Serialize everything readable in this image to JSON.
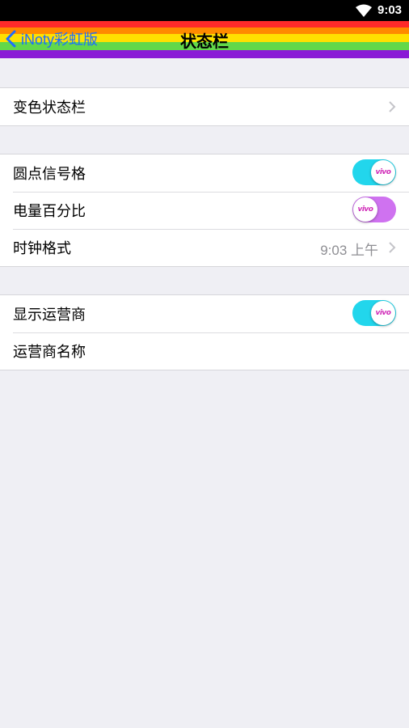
{
  "status_bar": {
    "time": "9:03",
    "icons": [
      "wifi-icon"
    ]
  },
  "navbar": {
    "back_label": "iNoty彩虹版",
    "title": "状态栏",
    "rainbow_colors": [
      "#ff2a2a",
      "#ff8a00",
      "#ffe000",
      "#62d84a",
      "#8a1ad6"
    ]
  },
  "groups": [
    {
      "rows": [
        {
          "label": "变色状态栏",
          "accessory": "chevron"
        }
      ]
    },
    {
      "rows": [
        {
          "label": "圆点信号格",
          "accessory": "toggle",
          "state": "on"
        },
        {
          "label": "电量百分比",
          "accessory": "toggle",
          "state": "off"
        },
        {
          "label": "时钟格式",
          "detail": "9:03 上午",
          "accessory": "chevron"
        }
      ]
    },
    {
      "rows": [
        {
          "label": "显示运营商",
          "accessory": "toggle",
          "state": "on"
        },
        {
          "label": "运营商名称"
        }
      ]
    }
  ],
  "toggle_knob_text": "vivo",
  "colors": {
    "toggle_on": "#22d6ec",
    "toggle_off": "#cf72f0",
    "accent": "#1e6cff"
  }
}
